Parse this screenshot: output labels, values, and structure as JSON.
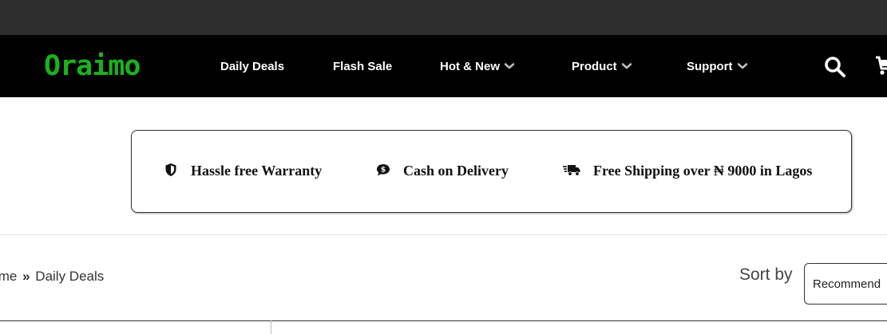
{
  "brand": {
    "logo_text": "Oraimo",
    "logo_color": "#1bb21b"
  },
  "nav": {
    "items": [
      {
        "label": "Daily Deals",
        "has_dropdown": false
      },
      {
        "label": "Flash Sale",
        "has_dropdown": false
      },
      {
        "label": "Hot & New",
        "has_dropdown": true
      },
      {
        "label": "Product",
        "has_dropdown": true
      },
      {
        "label": "Support",
        "has_dropdown": true
      }
    ],
    "icons": [
      "search-icon",
      "cart-icon"
    ]
  },
  "features": [
    {
      "icon": "shield-icon",
      "text": "Hassle free Warranty"
    },
    {
      "icon": "cash-icon",
      "text": "Cash on Delivery"
    },
    {
      "icon": "truck-icon",
      "text": "Free Shipping over ₦ 9000 in Lagos"
    }
  ],
  "breadcrumb": {
    "home": "Home",
    "separator": "»",
    "current": "Daily Deals"
  },
  "sort": {
    "label": "Sort by",
    "selected": "Recommend"
  },
  "colors": {
    "topbar": "#2d2d2d",
    "navbar": "#000000",
    "nav_text": "#ffffff"
  }
}
